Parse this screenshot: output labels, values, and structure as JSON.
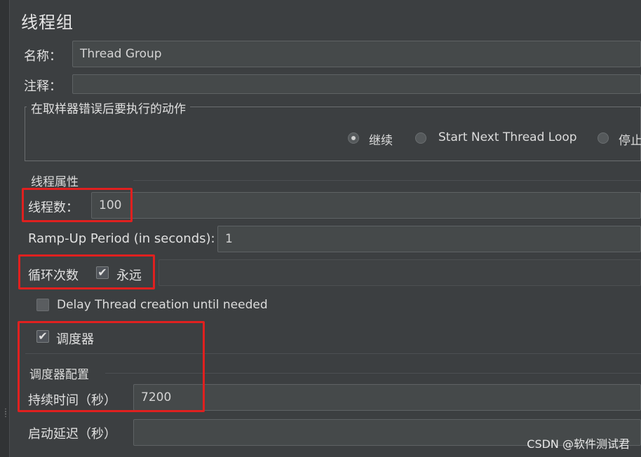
{
  "panel": {
    "title": "线程组",
    "name_label": "名称：",
    "name_value": "Thread Group",
    "comment_label": "注释："
  },
  "sampler_error": {
    "legend": "在取样器错误后要执行的动作",
    "options": [
      {
        "label": "继续",
        "selected": true
      },
      {
        "label": "Start Next Thread Loop",
        "selected": false
      },
      {
        "label": "停止",
        "selected": false
      }
    ]
  },
  "thread_props": {
    "heading": "线程属性",
    "threads_label": "线程数：",
    "threads_value": "100",
    "rampup_label": "Ramp-Up Period (in seconds):",
    "rampup_value": "1",
    "loop_label": "循环次数",
    "forever_label": "永远",
    "forever_checked": true,
    "delay_label": "Delay Thread creation until needed",
    "delay_checked": false,
    "scheduler_label": "调度器",
    "scheduler_checked": true
  },
  "scheduler_config": {
    "heading": "调度器配置",
    "duration_label": "持续时间（秒）",
    "duration_value": "7200",
    "startup_delay_label": "启动延迟（秒）",
    "startup_delay_value": ""
  },
  "watermark": "CSDN @软件测试君",
  "colors": {
    "background": "#3c3f41",
    "field": "#45494a",
    "highlight": "#e0201f"
  }
}
